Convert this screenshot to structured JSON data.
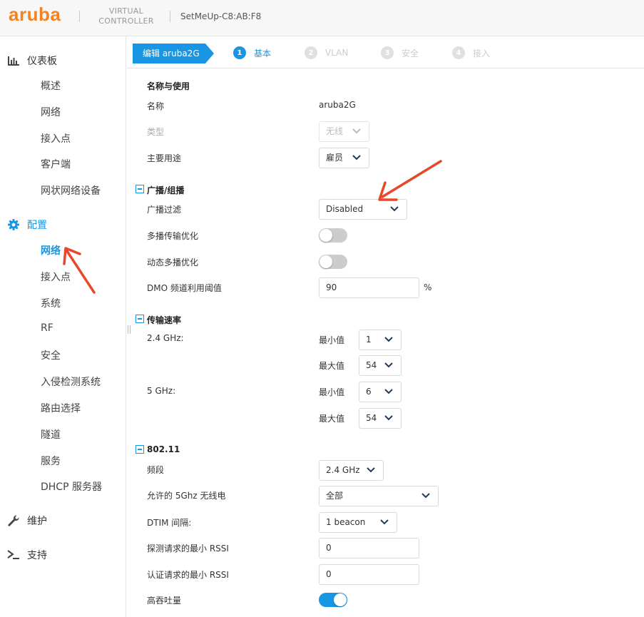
{
  "header": {
    "logo": "aruba",
    "product_line1": "VIRTUAL",
    "product_line2": "CONTROLLER",
    "device_name": "SetMeUp-C8:AB:F8"
  },
  "sidebar": {
    "dashboard": {
      "label": "仪表板",
      "icon": "bar-chart-icon"
    },
    "dashboard_items": [
      "概述",
      "网络",
      "接入点",
      "客户端",
      "网状网络设备"
    ],
    "configuration": {
      "label": "配置",
      "icon": "gear-icon"
    },
    "configuration_items": [
      "网络",
      "接入点",
      "系统",
      "RF",
      "安全",
      "入侵检测系统",
      "路由选择",
      "隧道",
      "服务",
      "DHCP 服务器"
    ],
    "active_item": "网络",
    "maintenance": {
      "label": "维护",
      "icon": "wrench-icon"
    },
    "support": {
      "label": "支持",
      "icon": "terminal-icon"
    }
  },
  "wizard": {
    "title": "编辑 aruba2G",
    "steps": [
      {
        "num": "1",
        "label": "基本",
        "active": true
      },
      {
        "num": "2",
        "label": "VLAN",
        "active": false
      },
      {
        "num": "3",
        "label": "安全",
        "active": false
      },
      {
        "num": "4",
        "label": "接入",
        "active": false
      }
    ]
  },
  "form": {
    "name_usage": {
      "title": "名称与使用",
      "name_label": "名称",
      "name_value": "aruba2G",
      "type_label": "类型",
      "type_value": "无线",
      "primary_usage_label": "主要用途",
      "primary_usage_value": "雇员"
    },
    "broadcast": {
      "title": "广播/组播",
      "broadcast_filter_label": "广播过滤",
      "broadcast_filter_value": "Disabled",
      "multicast_opt_label": "多播传输优化",
      "multicast_opt_on": false,
      "dynamic_multicast_label": "动态多播优化",
      "dynamic_multicast_on": false,
      "dmo_threshold_label": "DMO 频道利用阈值",
      "dmo_threshold_value": "90",
      "dmo_threshold_unit": "%"
    },
    "rates": {
      "title": "传输速率",
      "band24_label": "2.4 GHz:",
      "band5_label": "5 GHz:",
      "min_label": "最小值",
      "max_label": "最大值",
      "band24_min": "1",
      "band24_max": "54",
      "band5_min": "6",
      "band5_max": "54"
    },
    "dot11": {
      "title": "802.11",
      "band_label": "频段",
      "band_value": "2.4 GHz",
      "allowed_5g_label": "允许的 5Ghz 无线电",
      "allowed_5g_value": "全部",
      "dtim_label": "DTIM 间隔:",
      "dtim_value": "1 beacon",
      "probe_rssi_label": "探测请求的最小 RSSI",
      "probe_rssi_value": "0",
      "auth_rssi_label": "认证请求的最小 RSSI",
      "auth_rssi_value": "0",
      "high_throughput_label": "高吞吐量",
      "high_throughput_on": true
    }
  },
  "colors": {
    "accent": "#1896e4",
    "brand": "#f58220",
    "annotation_arrow": "#e8472a"
  }
}
